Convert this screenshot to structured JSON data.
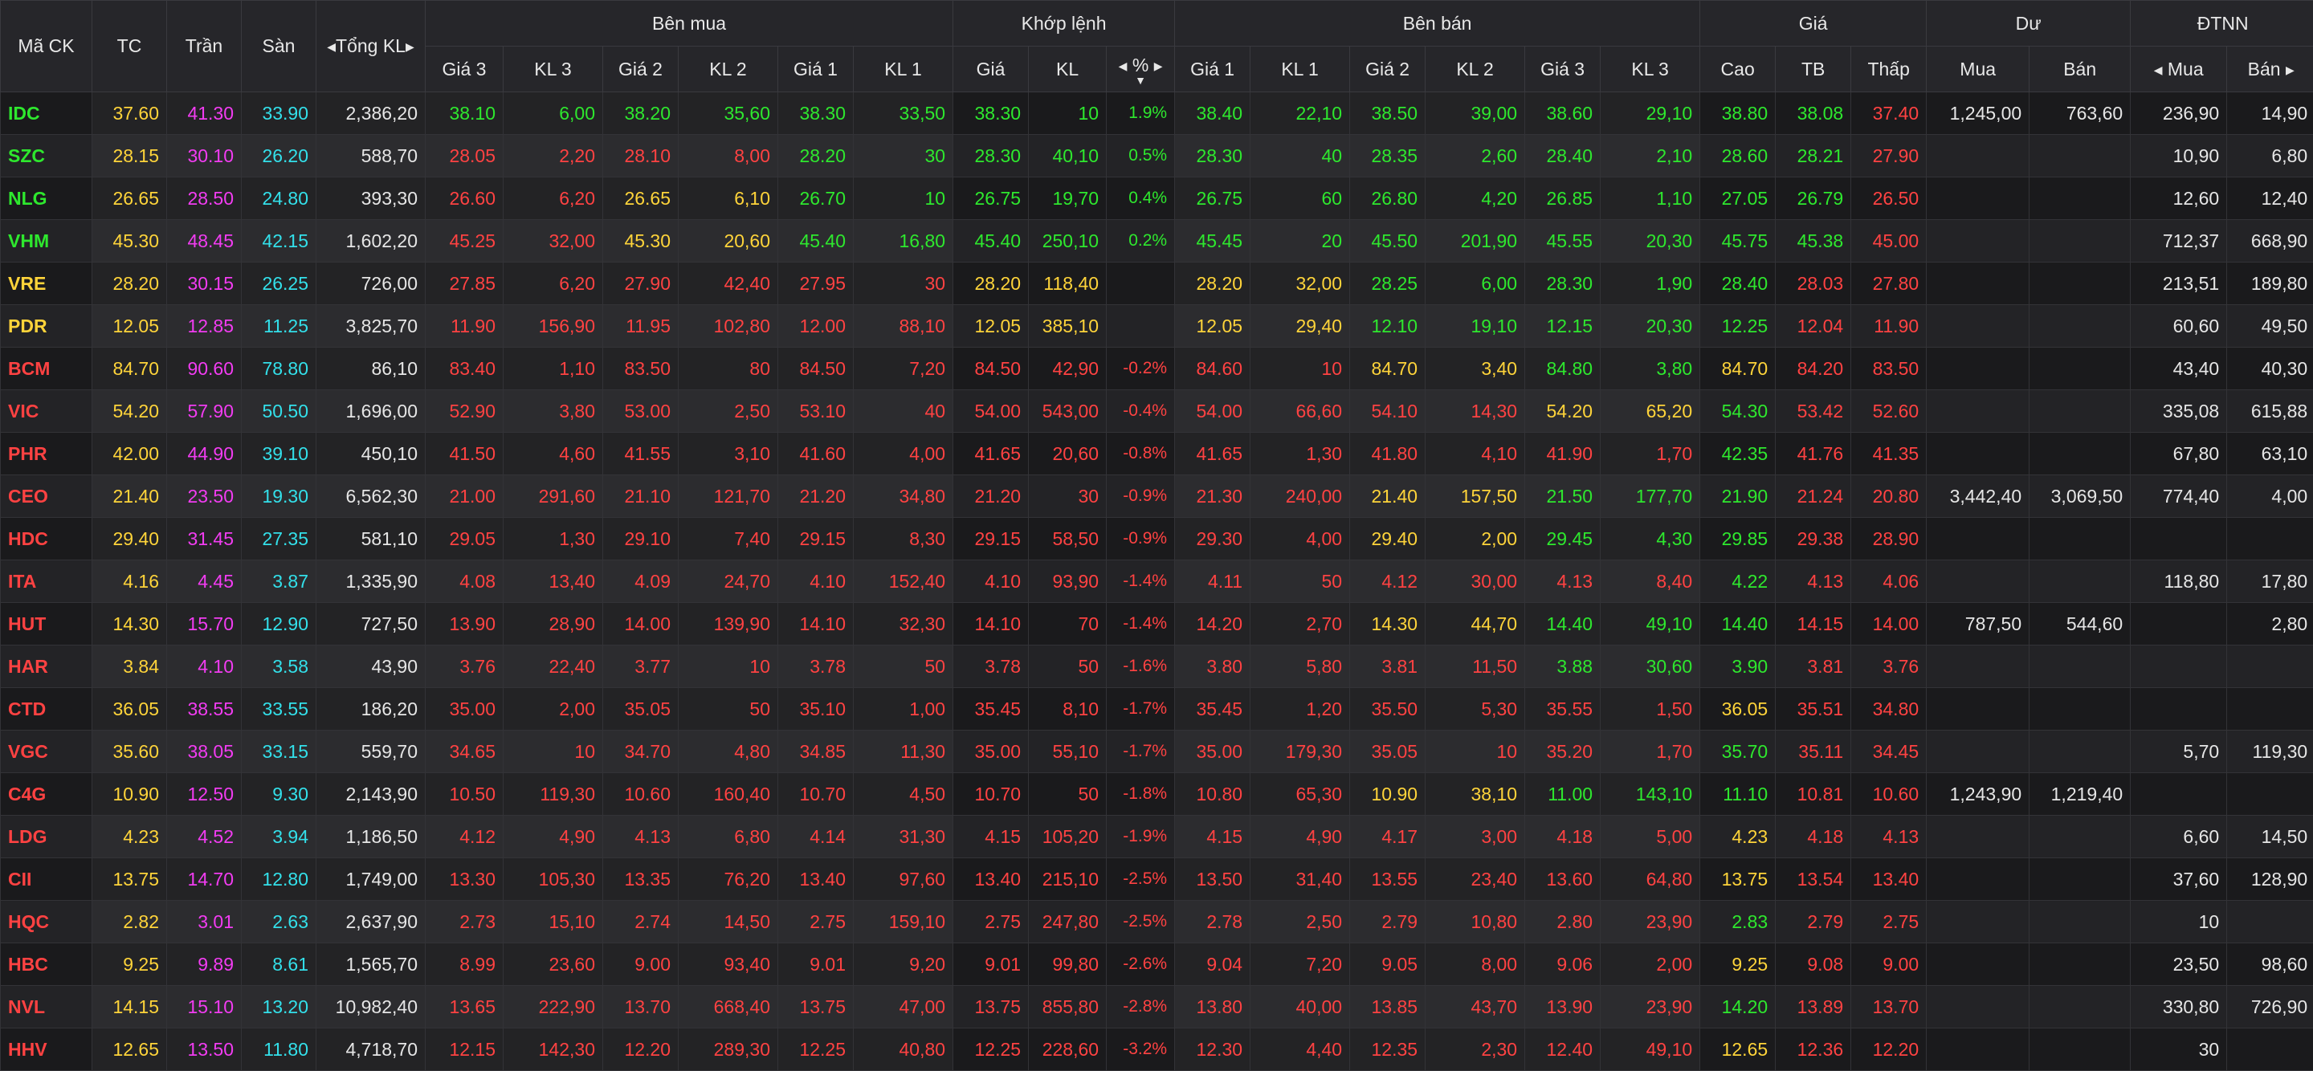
{
  "colors": {
    "up": "#2ee82e",
    "down": "#ff4242",
    "ref": "#ffd43a",
    "ceil": "#f23cf2",
    "floor": "#33e0ea",
    "neutral": "#e6e6e6",
    "background": "#1c1c1f"
  },
  "header": {
    "symbol": "Mã CK",
    "ref": "TC",
    "ceil": "Trần",
    "floor": "Sàn",
    "total_vol": "Tổng KL",
    "buy_group": "Bên mua",
    "match_group": "Khớp lệnh",
    "sell_group": "Bên bán",
    "price_group": "Giá",
    "residual_group": "Dư",
    "foreign_group": "ĐTNN",
    "buy_cols": [
      "Giá 3",
      "KL 3",
      "Giá 2",
      "KL 2",
      "Giá 1",
      "KL 1"
    ],
    "match_cols": [
      "Giá",
      "KL",
      "%"
    ],
    "sell_cols": [
      "Giá 1",
      "KL 1",
      "Giá 2",
      "KL 2",
      "Giá 3",
      "KL 3"
    ],
    "price_cols": [
      "Cao",
      "TB",
      "Thấp"
    ],
    "residual_cols": [
      "Mua",
      "Bán"
    ],
    "foreign_cols": [
      "Mua",
      "Bán"
    ]
  },
  "rows": [
    {
      "sym": "IDC",
      "tc": "37.60",
      "tran": "41.30",
      "san": "33.90",
      "tkl": "2,386,20",
      "b3": "38.10",
      "kb3": "6,00",
      "b2": "38.20",
      "kb2": "35,60",
      "b1": "38.30",
      "kb1": "33,50",
      "mp": "38.30",
      "mv": "10",
      "pct": "1.9%",
      "s1": "38.40",
      "ks1": "22,10",
      "s2": "38.50",
      "ks2": "39,00",
      "s3": "38.60",
      "ks3": "29,10",
      "high": "38.80",
      "avg": "38.08",
      "low": "37.40",
      "rb": "1,245,00",
      "rs": "763,60",
      "fb": "236,90",
      "fs": "14,90"
    },
    {
      "sym": "SZC",
      "tc": "28.15",
      "tran": "30.10",
      "san": "26.20",
      "tkl": "588,70",
      "b3": "28.05",
      "kb3": "2,20",
      "b2": "28.10",
      "kb2": "8,00",
      "b1": "28.20",
      "kb1": "30",
      "mp": "28.30",
      "mv": "40,10",
      "pct": "0.5%",
      "s1": "28.30",
      "ks1": "40",
      "s2": "28.35",
      "ks2": "2,60",
      "s3": "28.40",
      "ks3": "2,10",
      "high": "28.60",
      "avg": "28.21",
      "low": "27.90",
      "rb": "",
      "rs": "",
      "fb": "10,90",
      "fs": "6,80"
    },
    {
      "sym": "NLG",
      "tc": "26.65",
      "tran": "28.50",
      "san": "24.80",
      "tkl": "393,30",
      "b3": "26.60",
      "kb3": "6,20",
      "b2": "26.65",
      "kb2": "6,10",
      "b1": "26.70",
      "kb1": "10",
      "mp": "26.75",
      "mv": "19,70",
      "pct": "0.4%",
      "s1": "26.75",
      "ks1": "60",
      "s2": "26.80",
      "ks2": "4,20",
      "s3": "26.85",
      "ks3": "1,10",
      "high": "27.05",
      "avg": "26.79",
      "low": "26.50",
      "rb": "",
      "rs": "",
      "fb": "12,60",
      "fs": "12,40"
    },
    {
      "sym": "VHM",
      "tc": "45.30",
      "tran": "48.45",
      "san": "42.15",
      "tkl": "1,602,20",
      "b3": "45.25",
      "kb3": "32,00",
      "b2": "45.30",
      "kb2": "20,60",
      "b1": "45.40",
      "kb1": "16,80",
      "mp": "45.40",
      "mv": "250,10",
      "pct": "0.2%",
      "s1": "45.45",
      "ks1": "20",
      "s2": "45.50",
      "ks2": "201,90",
      "s3": "45.55",
      "ks3": "20,30",
      "high": "45.75",
      "avg": "45.38",
      "low": "45.00",
      "rb": "",
      "rs": "",
      "fb": "712,37",
      "fs": "668,90"
    },
    {
      "sym": "VRE",
      "tc": "28.20",
      "tran": "30.15",
      "san": "26.25",
      "tkl": "726,00",
      "b3": "27.85",
      "kb3": "6,20",
      "b2": "27.90",
      "kb2": "42,40",
      "b1": "27.95",
      "kb1": "30",
      "mp": "28.20",
      "mv": "118,40",
      "pct": "",
      "s1": "28.20",
      "ks1": "32,00",
      "s2": "28.25",
      "ks2": "6,00",
      "s3": "28.30",
      "ks3": "1,90",
      "high": "28.40",
      "avg": "28.03",
      "low": "27.80",
      "rb": "",
      "rs": "",
      "fb": "213,51",
      "fs": "189,80"
    },
    {
      "sym": "PDR",
      "tc": "12.05",
      "tran": "12.85",
      "san": "11.25",
      "tkl": "3,825,70",
      "b3": "11.90",
      "kb3": "156,90",
      "b2": "11.95",
      "kb2": "102,80",
      "b1": "12.00",
      "kb1": "88,10",
      "mp": "12.05",
      "mv": "385,10",
      "pct": "",
      "s1": "12.05",
      "ks1": "29,40",
      "s2": "12.10",
      "ks2": "19,10",
      "s3": "12.15",
      "ks3": "20,30",
      "high": "12.25",
      "avg": "12.04",
      "low": "11.90",
      "rb": "",
      "rs": "",
      "fb": "60,60",
      "fs": "49,50"
    },
    {
      "sym": "BCM",
      "tc": "84.70",
      "tran": "90.60",
      "san": "78.80",
      "tkl": "86,10",
      "b3": "83.40",
      "kb3": "1,10",
      "b2": "83.50",
      "kb2": "80",
      "b1": "84.50",
      "kb1": "7,20",
      "mp": "84.50",
      "mv": "42,90",
      "pct": "-0.2%",
      "s1": "84.60",
      "ks1": "10",
      "s2": "84.70",
      "ks2": "3,40",
      "s3": "84.80",
      "ks3": "3,80",
      "high": "84.70",
      "avg": "84.20",
      "low": "83.50",
      "rb": "",
      "rs": "",
      "fb": "43,40",
      "fs": "40,30"
    },
    {
      "sym": "VIC",
      "tc": "54.20",
      "tran": "57.90",
      "san": "50.50",
      "tkl": "1,696,00",
      "b3": "52.90",
      "kb3": "3,80",
      "b2": "53.00",
      "kb2": "2,50",
      "b1": "53.10",
      "kb1": "40",
      "mp": "54.00",
      "mv": "543,00",
      "pct": "-0.4%",
      "s1": "54.00",
      "ks1": "66,60",
      "s2": "54.10",
      "ks2": "14,30",
      "s3": "54.20",
      "ks3": "65,20",
      "high": "54.30",
      "avg": "53.42",
      "low": "52.60",
      "rb": "",
      "rs": "",
      "fb": "335,08",
      "fs": "615,88"
    },
    {
      "sym": "PHR",
      "tc": "42.00",
      "tran": "44.90",
      "san": "39.10",
      "tkl": "450,10",
      "b3": "41.50",
      "kb3": "4,60",
      "b2": "41.55",
      "kb2": "3,10",
      "b1": "41.60",
      "kb1": "4,00",
      "mp": "41.65",
      "mv": "20,60",
      "pct": "-0.8%",
      "s1": "41.65",
      "ks1": "1,30",
      "s2": "41.80",
      "ks2": "4,10",
      "s3": "41.90",
      "ks3": "1,70",
      "high": "42.35",
      "avg": "41.76",
      "low": "41.35",
      "rb": "",
      "rs": "",
      "fb": "67,80",
      "fs": "63,10"
    },
    {
      "sym": "CEO",
      "tc": "21.40",
      "tran": "23.50",
      "san": "19.30",
      "tkl": "6,562,30",
      "b3": "21.00",
      "kb3": "291,60",
      "b2": "21.10",
      "kb2": "121,70",
      "b1": "21.20",
      "kb1": "34,80",
      "mp": "21.20",
      "mv": "30",
      "pct": "-0.9%",
      "s1": "21.30",
      "ks1": "240,00",
      "s2": "21.40",
      "ks2": "157,50",
      "s3": "21.50",
      "ks3": "177,70",
      "high": "21.90",
      "avg": "21.24",
      "low": "20.80",
      "rb": "3,442,40",
      "rs": "3,069,50",
      "fb": "774,40",
      "fs": "4,00"
    },
    {
      "sym": "HDC",
      "tc": "29.40",
      "tran": "31.45",
      "san": "27.35",
      "tkl": "581,10",
      "b3": "29.05",
      "kb3": "1,30",
      "b2": "29.10",
      "kb2": "7,40",
      "b1": "29.15",
      "kb1": "8,30",
      "mp": "29.15",
      "mv": "58,50",
      "pct": "-0.9%",
      "s1": "29.30",
      "ks1": "4,00",
      "s2": "29.40",
      "ks2": "2,00",
      "s3": "29.45",
      "ks3": "4,30",
      "high": "29.85",
      "avg": "29.38",
      "low": "28.90",
      "rb": "",
      "rs": "",
      "fb": "",
      "fs": ""
    },
    {
      "sym": "ITA",
      "tc": "4.16",
      "tran": "4.45",
      "san": "3.87",
      "tkl": "1,335,90",
      "b3": "4.08",
      "kb3": "13,40",
      "b2": "4.09",
      "kb2": "24,70",
      "b1": "4.10",
      "kb1": "152,40",
      "mp": "4.10",
      "mv": "93,90",
      "pct": "-1.4%",
      "s1": "4.11",
      "ks1": "50",
      "s2": "4.12",
      "ks2": "30,00",
      "s3": "4.13",
      "ks3": "8,40",
      "high": "4.22",
      "avg": "4.13",
      "low": "4.06",
      "rb": "",
      "rs": "",
      "fb": "118,80",
      "fs": "17,80"
    },
    {
      "sym": "HUT",
      "tc": "14.30",
      "tran": "15.70",
      "san": "12.90",
      "tkl": "727,50",
      "b3": "13.90",
      "kb3": "28,90",
      "b2": "14.00",
      "kb2": "139,90",
      "b1": "14.10",
      "kb1": "32,30",
      "mp": "14.10",
      "mv": "70",
      "pct": "-1.4%",
      "s1": "14.20",
      "ks1": "2,70",
      "s2": "14.30",
      "ks2": "44,70",
      "s3": "14.40",
      "ks3": "49,10",
      "high": "14.40",
      "avg": "14.15",
      "low": "14.00",
      "rb": "787,50",
      "rs": "544,60",
      "fb": "",
      "fs": "2,80"
    },
    {
      "sym": "HAR",
      "tc": "3.84",
      "tran": "4.10",
      "san": "3.58",
      "tkl": "43,90",
      "b3": "3.76",
      "kb3": "22,40",
      "b2": "3.77",
      "kb2": "10",
      "b1": "3.78",
      "kb1": "50",
      "mp": "3.78",
      "mv": "50",
      "pct": "-1.6%",
      "s1": "3.80",
      "ks1": "5,80",
      "s2": "3.81",
      "ks2": "11,50",
      "s3": "3.88",
      "ks3": "30,60",
      "high": "3.90",
      "avg": "3.81",
      "low": "3.76",
      "rb": "",
      "rs": "",
      "fb": "",
      "fs": ""
    },
    {
      "sym": "CTD",
      "tc": "36.05",
      "tran": "38.55",
      "san": "33.55",
      "tkl": "186,20",
      "b3": "35.00",
      "kb3": "2,00",
      "b2": "35.05",
      "kb2": "50",
      "b1": "35.10",
      "kb1": "1,00",
      "mp": "35.45",
      "mv": "8,10",
      "pct": "-1.7%",
      "s1": "35.45",
      "ks1": "1,20",
      "s2": "35.50",
      "ks2": "5,30",
      "s3": "35.55",
      "ks3": "1,50",
      "high": "36.05",
      "avg": "35.51",
      "low": "34.80",
      "rb": "",
      "rs": "",
      "fb": "",
      "fs": ""
    },
    {
      "sym": "VGC",
      "tc": "35.60",
      "tran": "38.05",
      "san": "33.15",
      "tkl": "559,70",
      "b3": "34.65",
      "kb3": "10",
      "b2": "34.70",
      "kb2": "4,80",
      "b1": "34.85",
      "kb1": "11,30",
      "mp": "35.00",
      "mv": "55,10",
      "pct": "-1.7%",
      "s1": "35.00",
      "ks1": "179,30",
      "s2": "35.05",
      "ks2": "10",
      "s3": "35.20",
      "ks3": "1,70",
      "high": "35.70",
      "avg": "35.11",
      "low": "34.45",
      "rb": "",
      "rs": "",
      "fb": "5,70",
      "fs": "119,30"
    },
    {
      "sym": "C4G",
      "tc": "10.90",
      "tran": "12.50",
      "san": "9.30",
      "tkl": "2,143,90",
      "b3": "10.50",
      "kb3": "119,30",
      "b2": "10.60",
      "kb2": "160,40",
      "b1": "10.70",
      "kb1": "4,50",
      "mp": "10.70",
      "mv": "50",
      "pct": "-1.8%",
      "s1": "10.80",
      "ks1": "65,30",
      "s2": "10.90",
      "ks2": "38,10",
      "s3": "11.00",
      "ks3": "143,10",
      "high": "11.10",
      "avg": "10.81",
      "low": "10.60",
      "rb": "1,243,90",
      "rs": "1,219,40",
      "fb": "",
      "fs": ""
    },
    {
      "sym": "LDG",
      "tc": "4.23",
      "tran": "4.52",
      "san": "3.94",
      "tkl": "1,186,50",
      "b3": "4.12",
      "kb3": "4,90",
      "b2": "4.13",
      "kb2": "6,80",
      "b1": "4.14",
      "kb1": "31,30",
      "mp": "4.15",
      "mv": "105,20",
      "pct": "-1.9%",
      "s1": "4.15",
      "ks1": "4,90",
      "s2": "4.17",
      "ks2": "3,00",
      "s3": "4.18",
      "ks3": "5,00",
      "high": "4.23",
      "avg": "4.18",
      "low": "4.13",
      "rb": "",
      "rs": "",
      "fb": "6,60",
      "fs": "14,50"
    },
    {
      "sym": "CII",
      "tc": "13.75",
      "tran": "14.70",
      "san": "12.80",
      "tkl": "1,749,00",
      "b3": "13.30",
      "kb3": "105,30",
      "b2": "13.35",
      "kb2": "76,20",
      "b1": "13.40",
      "kb1": "97,60",
      "mp": "13.40",
      "mv": "215,10",
      "pct": "-2.5%",
      "s1": "13.50",
      "ks1": "31,40",
      "s2": "13.55",
      "ks2": "23,40",
      "s3": "13.60",
      "ks3": "64,80",
      "high": "13.75",
      "avg": "13.54",
      "low": "13.40",
      "rb": "",
      "rs": "",
      "fb": "37,60",
      "fs": "128,90"
    },
    {
      "sym": "HQC",
      "tc": "2.82",
      "tran": "3.01",
      "san": "2.63",
      "tkl": "2,637,90",
      "b3": "2.73",
      "kb3": "15,10",
      "b2": "2.74",
      "kb2": "14,50",
      "b1": "2.75",
      "kb1": "159,10",
      "mp": "2.75",
      "mv": "247,80",
      "pct": "-2.5%",
      "s1": "2.78",
      "ks1": "2,50",
      "s2": "2.79",
      "ks2": "10,80",
      "s3": "2.80",
      "ks3": "23,90",
      "high": "2.83",
      "avg": "2.79",
      "low": "2.75",
      "rb": "",
      "rs": "",
      "fb": "10",
      "fs": ""
    },
    {
      "sym": "HBC",
      "tc": "9.25",
      "tran": "9.89",
      "san": "8.61",
      "tkl": "1,565,70",
      "b3": "8.99",
      "kb3": "23,60",
      "b2": "9.00",
      "kb2": "93,40",
      "b1": "9.01",
      "kb1": "9,20",
      "mp": "9.01",
      "mv": "99,80",
      "pct": "-2.6%",
      "s1": "9.04",
      "ks1": "7,20",
      "s2": "9.05",
      "ks2": "8,00",
      "s3": "9.06",
      "ks3": "2,00",
      "high": "9.25",
      "avg": "9.08",
      "low": "9.00",
      "rb": "",
      "rs": "",
      "fb": "23,50",
      "fs": "98,60"
    },
    {
      "sym": "NVL",
      "tc": "14.15",
      "tran": "15.10",
      "san": "13.20",
      "tkl": "10,982,40",
      "b3": "13.65",
      "kb3": "222,90",
      "b2": "13.70",
      "kb2": "668,40",
      "b1": "13.75",
      "kb1": "47,00",
      "mp": "13.75",
      "mv": "855,80",
      "pct": "-2.8%",
      "s1": "13.80",
      "ks1": "40,00",
      "s2": "13.85",
      "ks2": "43,70",
      "s3": "13.90",
      "ks3": "23,90",
      "high": "14.20",
      "avg": "13.89",
      "low": "13.70",
      "rb": "",
      "rs": "",
      "fb": "330,80",
      "fs": "726,90"
    },
    {
      "sym": "HHV",
      "tc": "12.65",
      "tran": "13.50",
      "san": "11.80",
      "tkl": "4,718,70",
      "b3": "12.15",
      "kb3": "142,30",
      "b2": "12.20",
      "kb2": "289,30",
      "b1": "12.25",
      "kb1": "40,80",
      "mp": "12.25",
      "mv": "228,60",
      "pct": "-3.2%",
      "s1": "12.30",
      "ks1": "4,40",
      "s2": "12.35",
      "ks2": "2,30",
      "s3": "12.40",
      "ks3": "49,10",
      "high": "12.65",
      "avg": "12.36",
      "low": "12.20",
      "rb": "",
      "rs": "",
      "fb": "30",
      "fs": ""
    }
  ]
}
